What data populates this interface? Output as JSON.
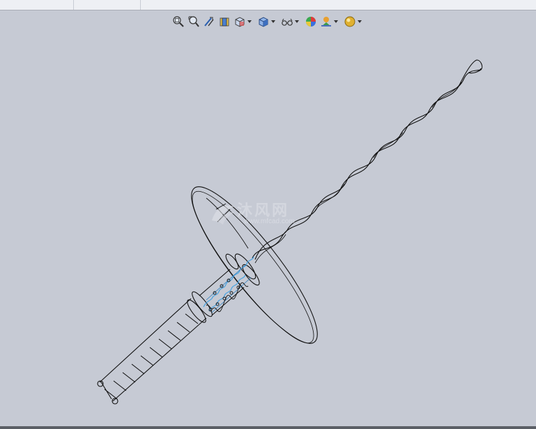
{
  "toolbar": {
    "items": [
      {
        "name": "zoom-to-fit",
        "icon": "zoom-to-fit-icon",
        "dropdown": false
      },
      {
        "name": "zoom-to-area",
        "icon": "zoom-to-area-icon",
        "dropdown": false
      },
      {
        "name": "previous-view",
        "icon": "previous-view-icon",
        "dropdown": false
      },
      {
        "name": "section-view",
        "icon": "section-view-icon",
        "dropdown": false
      },
      {
        "name": "view-orientation",
        "icon": "view-orientation-icon",
        "dropdown": true
      },
      {
        "name": "display-style",
        "icon": "display-style-icon",
        "dropdown": true
      },
      {
        "name": "hide-show-items",
        "icon": "hide-show-items-icon",
        "dropdown": true
      },
      {
        "name": "edit-appearance",
        "icon": "edit-appearance-icon",
        "dropdown": false
      },
      {
        "name": "apply-scene",
        "icon": "apply-scene-icon",
        "dropdown": true
      },
      {
        "name": "view-settings",
        "icon": "view-settings-icon",
        "dropdown": true
      }
    ]
  },
  "watermark": {
    "title": "沐风网",
    "subtitle": "www.mfcad.com"
  },
  "colors": {
    "background": "#c6cad4",
    "wire": "#111111",
    "highlight": "#4aa3e0"
  }
}
